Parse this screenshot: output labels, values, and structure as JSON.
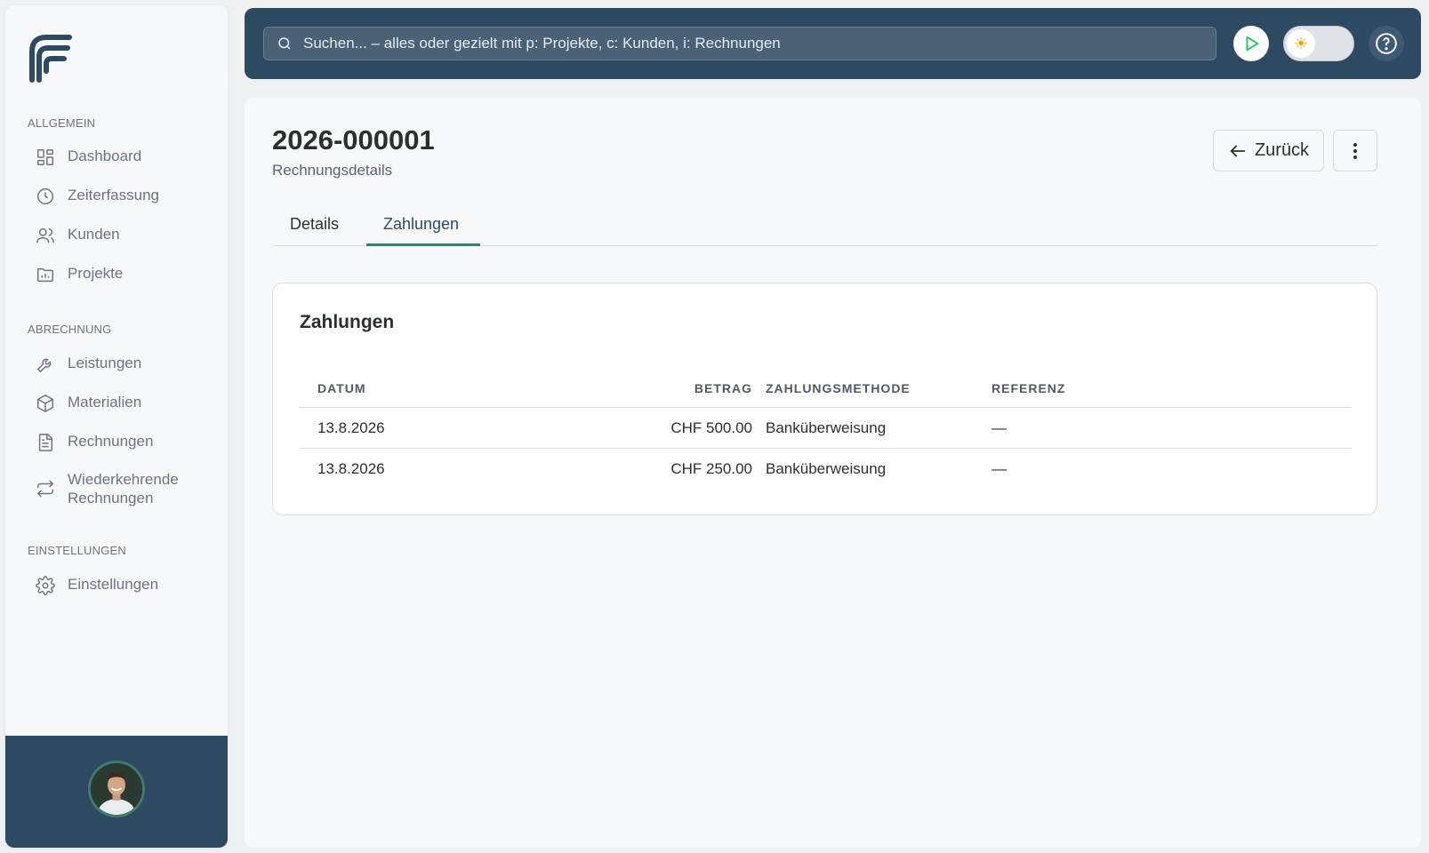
{
  "sidebar": {
    "sections": [
      {
        "title": "ALLGEMEIN"
      },
      {
        "title": "ABRECHNUNG"
      },
      {
        "title": "EINSTELLUNGEN"
      }
    ],
    "items": [
      {
        "label": "Dashboard",
        "icon": "dashboard-icon"
      },
      {
        "label": "Zeiterfassung",
        "icon": "clock-icon"
      },
      {
        "label": "Kunden",
        "icon": "users-icon"
      },
      {
        "label": "Projekte",
        "icon": "folder-chart-icon"
      },
      {
        "label": "Leistungen",
        "icon": "wrench-icon"
      },
      {
        "label": "Materialien",
        "icon": "package-icon"
      },
      {
        "label": "Rechnungen",
        "icon": "file-icon"
      },
      {
        "label": "Wiederkehrende Rechnungen",
        "icon": "repeat-icon"
      },
      {
        "label": "Einstellungen",
        "icon": "gear-icon"
      }
    ]
  },
  "topbar": {
    "search_placeholder": "Suchen... – alles oder gezielt mit p: Projekte, c: Kunden, i: Rechnungen"
  },
  "page": {
    "title": "2026-000001",
    "subtitle": "Rechnungsdetails",
    "back_label": "Zurück"
  },
  "tabs": [
    {
      "label": "Details",
      "active": false
    },
    {
      "label": "Zahlungen",
      "active": true
    }
  ],
  "payments": {
    "title": "Zahlungen",
    "columns": [
      "DATUM",
      "BETRAG",
      "ZAHLUNGSMETHODE",
      "REFERENZ"
    ],
    "rows": [
      {
        "date": "13.8.2026",
        "amount": "CHF 500.00",
        "method": "Banküberweisung",
        "reference": "—"
      },
      {
        "date": "13.8.2026",
        "amount": "CHF 250.00",
        "method": "Banküberweisung",
        "reference": "—"
      }
    ]
  },
  "colors": {
    "primary": "#2e4a63",
    "accent": "#3f7a6d",
    "play": "#22c55e",
    "sun": "#f59e0b"
  }
}
